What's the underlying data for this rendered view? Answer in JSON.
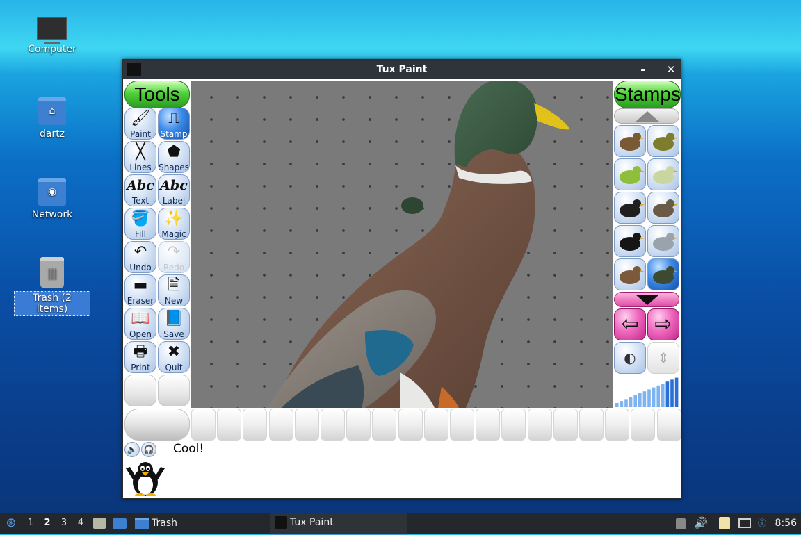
{
  "desktop": {
    "icons": [
      {
        "label": "Computer"
      },
      {
        "label": "dartz"
      },
      {
        "label": "Network"
      },
      {
        "label": "Trash (2 items)"
      }
    ]
  },
  "window": {
    "title": "Tux Paint",
    "minimize_glyph": "–",
    "close_glyph": "✕"
  },
  "tuxpaint": {
    "tools_title": "Tools",
    "stamps_title": "Stamps",
    "tools": [
      {
        "label": "Paint",
        "icon": "paintbrush-icon",
        "glyph": "🖌"
      },
      {
        "label": "Stamp",
        "icon": "stamp-icon",
        "glyph": "⎍",
        "active": true
      },
      {
        "label": "Lines",
        "icon": "lines-icon",
        "glyph": "╳"
      },
      {
        "label": "Shapes",
        "icon": "pentagon-icon",
        "glyph": "⬟"
      },
      {
        "label": "Text",
        "icon": "text-icon",
        "glyph": "Abc"
      },
      {
        "label": "Label",
        "icon": "label-icon",
        "glyph": "Abc"
      },
      {
        "label": "Fill",
        "icon": "bucket-icon",
        "glyph": "🪣"
      },
      {
        "label": "Magic",
        "icon": "magic-wand-icon",
        "glyph": "✨"
      },
      {
        "label": "Undo",
        "icon": "undo-icon",
        "glyph": "↶"
      },
      {
        "label": "Redo",
        "icon": "redo-icon",
        "glyph": "↷",
        "disabled": true
      },
      {
        "label": "Eraser",
        "icon": "eraser-icon",
        "glyph": "▬"
      },
      {
        "label": "New",
        "icon": "new-page-icon",
        "glyph": "🗎"
      },
      {
        "label": "Open",
        "icon": "open-book-icon",
        "glyph": "📖"
      },
      {
        "label": "Save",
        "icon": "save-book-icon",
        "glyph": "📘"
      },
      {
        "label": "Print",
        "icon": "printer-icon",
        "glyph": "🖶"
      },
      {
        "label": "Quit",
        "icon": "quit-x-icon",
        "glyph": "✖"
      }
    ],
    "stamps": [
      {
        "name": "frog-stamp",
        "color": "#7a5a35"
      },
      {
        "name": "toad-stamp",
        "color": "#7d7d2d"
      },
      {
        "name": "parrot-stamp",
        "color": "#8fbf3a"
      },
      {
        "name": "heron-stamp",
        "color": "#c9d6a0"
      },
      {
        "name": "blackbird-stamp",
        "color": "#1f1f1f"
      },
      {
        "name": "hen-stamp",
        "color": "#6b5a45"
      },
      {
        "name": "crow-stamp",
        "color": "#151515"
      },
      {
        "name": "crane-stamp",
        "color": "#9aa3ab"
      },
      {
        "name": "seal-stamp",
        "color": "#7a5a3a"
      },
      {
        "name": "duck-stamp",
        "color": "#3e4a30",
        "active": true
      }
    ],
    "message": "Cool!",
    "swatch_count": 19
  },
  "taskbar": {
    "workspaces": [
      "1",
      "2",
      "3",
      "4"
    ],
    "active_workspace": "2",
    "launcher_trash": "Trash",
    "task_title": "Tux Paint",
    "clock": "8:56"
  }
}
